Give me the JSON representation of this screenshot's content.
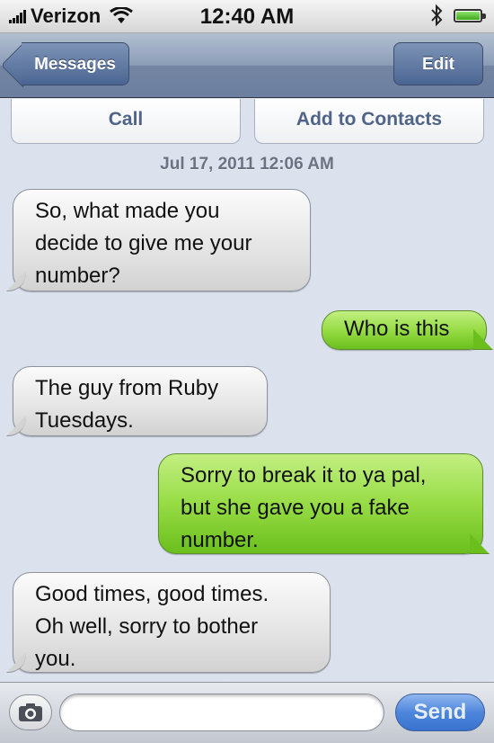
{
  "status_bar": {
    "carrier": "Verizon",
    "time": "12:40 AM"
  },
  "nav": {
    "back_label": "Messages",
    "edit_label": "Edit"
  },
  "actions": {
    "call_label": "Call",
    "add_contacts_label": "Add to Contacts"
  },
  "timestamp": "Jul 17, 2011 12:06 AM",
  "messages": [
    {
      "from": "them",
      "text": "So, what made you\ndecide to give me your\nnumber?"
    },
    {
      "from": "me",
      "text": "Who is this"
    },
    {
      "from": "them",
      "text": "The guy from Ruby\nTuesdays."
    },
    {
      "from": "me",
      "text": "Sorry to break it to ya pal,\nbut she gave you a fake\nnumber."
    },
    {
      "from": "them",
      "text": "Good times, good times.\nOh well, sorry to bother\nyou."
    }
  ],
  "composer": {
    "placeholder": "",
    "send_label": "Send"
  },
  "colors": {
    "incoming": "#e6e6e6",
    "outgoing": "#97dc45",
    "nav": "#7385a2",
    "send": "#4e86dc"
  },
  "icons": {
    "signal": "signal-bars-icon",
    "wifi": "wifi-icon",
    "bluetooth": "bluetooth-icon",
    "battery": "battery-icon",
    "camera": "camera-icon"
  }
}
